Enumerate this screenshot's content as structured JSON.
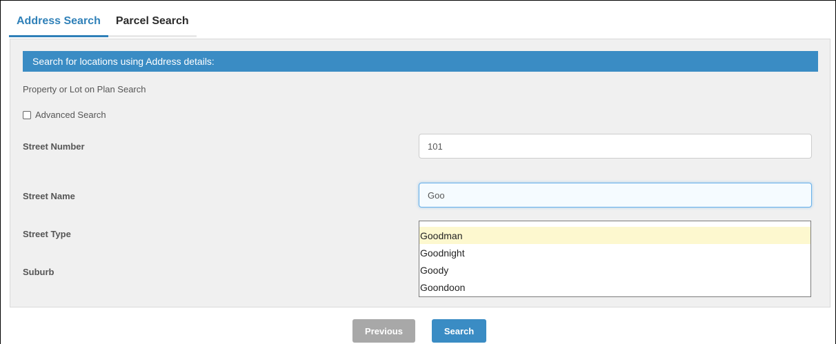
{
  "tabs": [
    {
      "label": "Address Search",
      "active": true
    },
    {
      "label": "Parcel Search",
      "active": false
    }
  ],
  "panel": {
    "banner": "Search for locations using Address details:",
    "subheading": "Property or Lot on Plan Search",
    "advanced_search_label": "Advanced Search",
    "advanced_search_checked": false
  },
  "fields": {
    "street_number": {
      "label": "Street Number",
      "value": "101"
    },
    "street_name": {
      "label": "Street Name",
      "value": "Goo"
    },
    "street_type": {
      "label": "Street Type"
    },
    "suburb": {
      "label": "Suburb"
    }
  },
  "autocomplete": {
    "options": [
      "Goodman",
      "Goodnight",
      "Goody",
      "Goondoon"
    ],
    "highlighted_index": 0
  },
  "buttons": {
    "previous": "Previous",
    "search": "Search"
  },
  "colors": {
    "accent": "#3a8cc4",
    "highlight": "#fdf8cf",
    "disabled_button": "#a8a8a8"
  }
}
